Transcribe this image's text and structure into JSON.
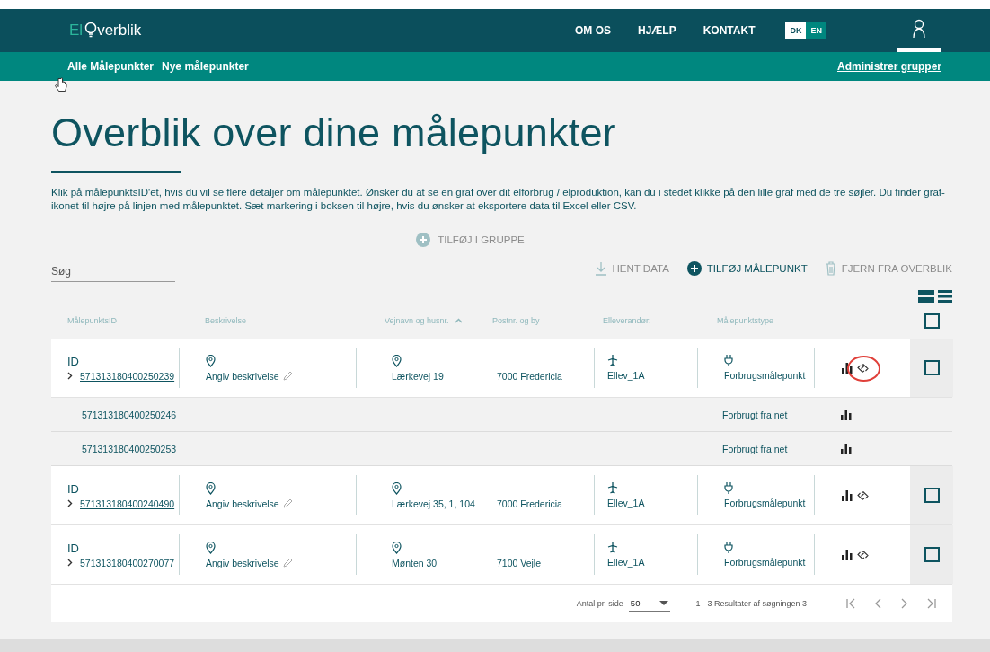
{
  "header": {
    "logo": {
      "prefix": "El",
      "rest": "verblik"
    },
    "nav": [
      "OM OS",
      "HJÆLP",
      "KONTAKT"
    ],
    "languages": [
      {
        "label": "DK",
        "selected": true
      },
      {
        "label": "EN",
        "selected": false
      }
    ]
  },
  "subnav": {
    "tabs": [
      "Alle Målepunkter",
      "Nye målepunkter"
    ],
    "link": "Administrer grupper"
  },
  "title": "Overblik over dine målepunkter",
  "intro": "Klik på målepunktsID'et, hvis du vil se flere detaljer om målepunktet. Ønsker du at se en graf over dit elforbrug / elproduktion, kan du i stedet klikke på den lille graf med de tre søjler. Du finder graf-ikonet til højre på linjen med målepunktet. Sæt markering i boksen til højre, hvis du ønsker at eksportere data til Excel eller CSV.",
  "add_to_group": {
    "label": "TILFØJ I GRUPPE",
    "disabled": true
  },
  "search": {
    "placeholder": "Søg"
  },
  "toolbar": [
    {
      "kind": "download",
      "label": "HENT DATA",
      "disabled": true
    },
    {
      "kind": "add",
      "label": "TILFØJ MÅLEPUNKT",
      "disabled": false
    },
    {
      "kind": "delete",
      "label": "FJERN FRA OVERBLIK",
      "disabled": true
    }
  ],
  "columns": [
    {
      "label": "MålepunktsID"
    },
    {
      "label": "Beskrivelse"
    },
    {
      "label": "Vejnavn og husnr.",
      "sorted": true
    },
    {
      "label": "Postnr. og by"
    },
    {
      "label": "Elleverandør:"
    },
    {
      "label": "Målepunktstype"
    }
  ],
  "select_all": {
    "checked": false
  },
  "rows": [
    {
      "id_label": "ID",
      "id": "571313180400250239",
      "description": "Angiv beskrivelse",
      "address": "Lærkevej 19",
      "city": "7000 Fredericia",
      "supplier": "Ellev_1A",
      "type": "Forbrugsmålepunkt",
      "highlighted": true,
      "checked": false,
      "children": [
        {
          "id": "571313180400250246",
          "type": "Forbrugt fra net"
        },
        {
          "id": "571313180400250253",
          "type": "Forbrugt fra net"
        }
      ]
    },
    {
      "id_label": "ID",
      "id": "571313180400240490",
      "description": "Angiv beskrivelse",
      "address": "Lærkevej 35, 1, 104",
      "city": "7000 Fredericia",
      "supplier": "Ellev_1A",
      "type": "Forbrugsmålepunkt",
      "checked": false
    },
    {
      "id_label": "ID",
      "id": "571313180400270077",
      "description": "Angiv beskrivelse",
      "address": "Mønten 30",
      "city": "7100 Vejle",
      "supplier": "Ellev_1A",
      "type": "Forbrugsmålepunkt",
      "checked": false
    }
  ],
  "pagination": {
    "per_page_label": "Antal pr. side",
    "per_page": "50",
    "results": "1 - 3 Resultater af søgningen 3"
  }
}
